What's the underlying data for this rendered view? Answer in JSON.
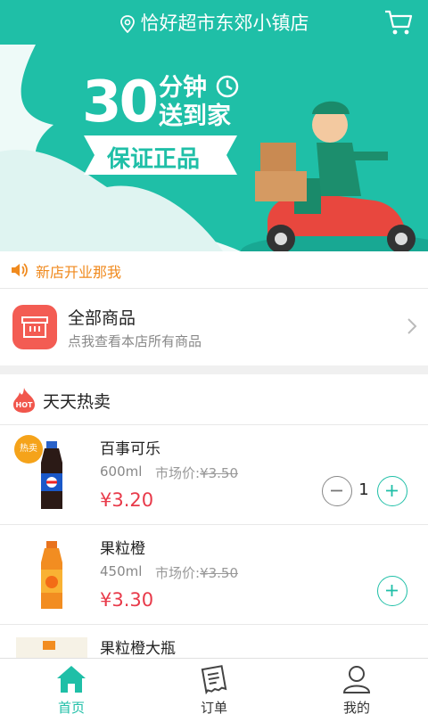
{
  "header": {
    "store_name": "恰好超市东郊小镇店"
  },
  "banner": {
    "minutes": "30",
    "line1": "分钟",
    "line2": "送到家",
    "slogan": "保证正品"
  },
  "notice": {
    "text": "新店开业那我"
  },
  "all_products": {
    "title": "全部商品",
    "subtitle": "点我查看本店所有商品"
  },
  "hot": {
    "title": "天天热卖",
    "hot_tag": "热卖",
    "items": [
      {
        "name": "百事可乐",
        "spec": "600ml",
        "market_label": "市场价:",
        "market_price": "¥3.50",
        "price": "¥3.20",
        "qty": "1"
      },
      {
        "name": "果粒橙",
        "spec": "450ml",
        "market_label": "市场价:",
        "market_price": "¥3.50",
        "price": "¥3.30"
      },
      {
        "name": "果粒橙大瓶"
      }
    ]
  },
  "nav": {
    "home": "首页",
    "orders": "订单",
    "mine": "我的"
  },
  "colors": {
    "accent": "#1fbfa7",
    "price": "#e83a4a",
    "notice": "#f08a1e"
  }
}
